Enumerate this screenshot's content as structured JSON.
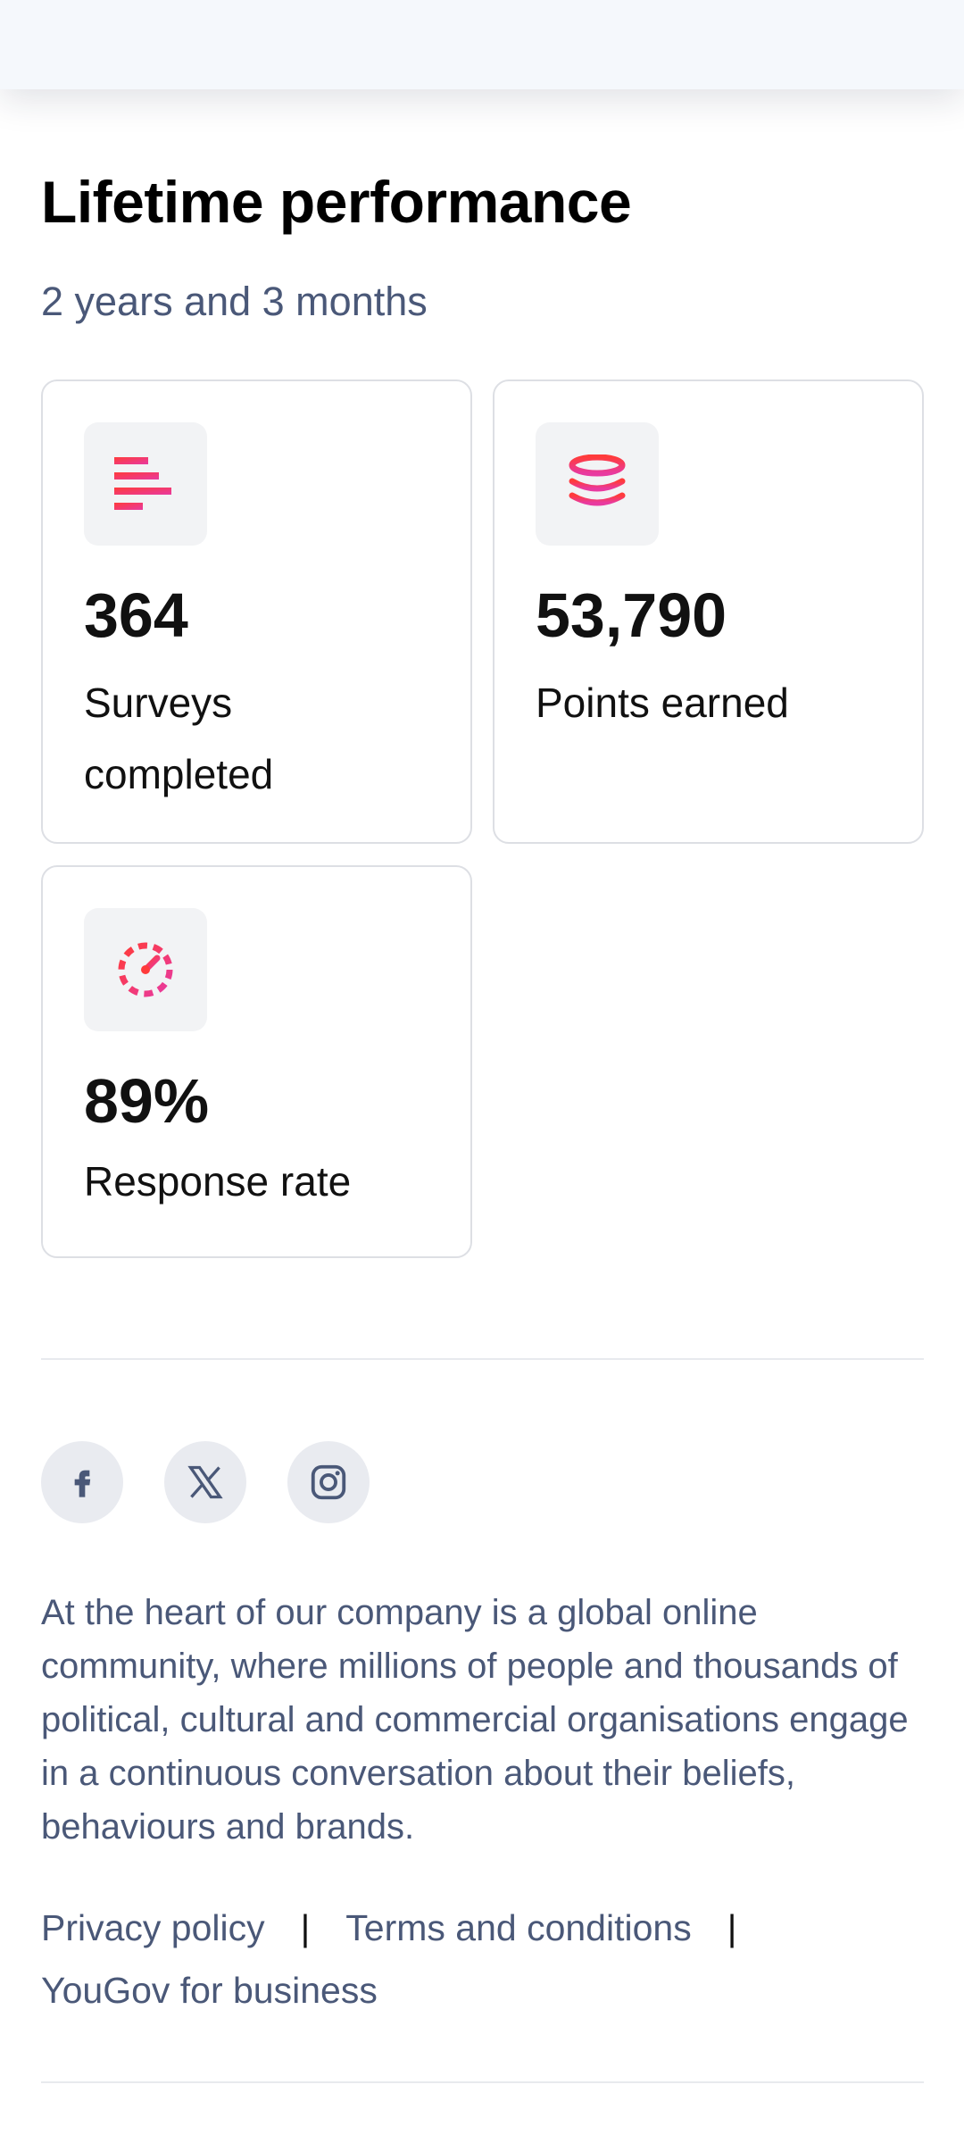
{
  "page": {
    "title": "Lifetime performance",
    "subtitle": "2 years and 3 months"
  },
  "stats": [
    {
      "icon": "bar-list-icon",
      "value": "364",
      "label": "Surveys completed"
    },
    {
      "icon": "coins-stack-icon",
      "value": "53,790",
      "label": "Points earned"
    },
    {
      "icon": "speedometer-icon",
      "value": "89%",
      "label": "Response rate"
    }
  ],
  "social": [
    {
      "icon": "facebook-icon"
    },
    {
      "icon": "x-twitter-icon"
    },
    {
      "icon": "instagram-icon"
    }
  ],
  "footer": {
    "about": "At the heart of our company is a global online community, where millions of people and thousands of political, cultural and commercial organisations engage in a continuous conversation about their beliefs, behaviours and brands.",
    "links": {
      "privacy": "Privacy policy",
      "terms": "Terms and conditions",
      "business": "YouGov for business",
      "separator": "|"
    }
  },
  "colors": {
    "accent_start": "#ff3b3b",
    "accent_end": "#e83aa0",
    "muted_text": "#4a5878"
  }
}
